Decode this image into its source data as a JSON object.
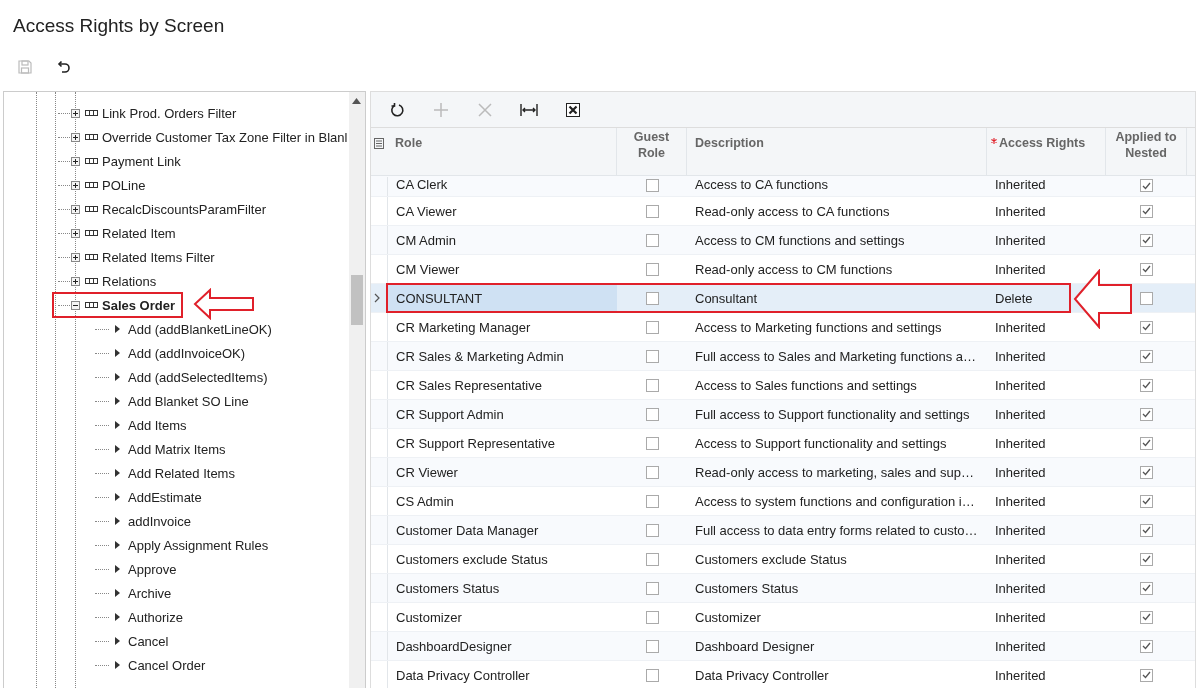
{
  "page": {
    "title": "Access Rights by Screen"
  },
  "toolbar": [
    {
      "kind": "save",
      "disabled": true
    },
    {
      "kind": "undo",
      "disabled": false
    }
  ],
  "tree": {
    "items": [
      {
        "label": "Link Prod. Orders Filter",
        "expanded": false,
        "highlighted": false
      },
      {
        "label": "Override Customer Tax Zone Filter in Blanl",
        "expanded": false,
        "highlighted": false
      },
      {
        "label": "Payment Link",
        "expanded": false,
        "highlighted": false
      },
      {
        "label": "POLine",
        "expanded": false,
        "highlighted": false
      },
      {
        "label": "RecalcDiscountsParamFilter",
        "expanded": false,
        "highlighted": false
      },
      {
        "label": "Related Item",
        "expanded": false,
        "highlighted": false
      },
      {
        "label": "Related Items Filter",
        "expanded": false,
        "highlighted": false
      },
      {
        "label": "Relations",
        "expanded": false,
        "highlighted": false
      },
      {
        "label": "Sales Order",
        "expanded": true,
        "highlighted": true,
        "children": [
          {
            "label": "Add (addBlanketLineOK)",
            "expanded": false
          },
          {
            "label": "Add (addInvoiceOK)",
            "expanded": false
          },
          {
            "label": "Add (addSelectedItems)",
            "expanded": false
          },
          {
            "label": "Add Blanket SO Line",
            "expanded": false
          },
          {
            "label": "Add Items",
            "expanded": false
          },
          {
            "label": "Add Matrix Items",
            "expanded": false
          },
          {
            "label": "Add Related Items",
            "expanded": false
          },
          {
            "label": "AddEstimate",
            "expanded": false
          },
          {
            "label": "addInvoice",
            "expanded": false
          },
          {
            "label": "Apply Assignment Rules",
            "expanded": false
          },
          {
            "label": "Approve",
            "expanded": false
          },
          {
            "label": "Archive",
            "expanded": false
          },
          {
            "label": "Authorize",
            "expanded": false
          },
          {
            "label": "Cancel",
            "expanded": false
          },
          {
            "label": "Cancel Order",
            "expanded": false
          }
        ]
      }
    ]
  },
  "grid": {
    "toolbar": [
      {
        "kind": "refresh",
        "disabled": false
      },
      {
        "kind": "add",
        "disabled": true
      },
      {
        "kind": "delete",
        "disabled": true
      },
      {
        "kind": "fit",
        "disabled": false
      },
      {
        "kind": "excel",
        "disabled": false
      }
    ],
    "columns": [
      {
        "label": "Role",
        "required": false
      },
      {
        "label": "Guest Role",
        "required": false
      },
      {
        "label": "Description",
        "required": false
      },
      {
        "label": "Access Rights",
        "required": true
      },
      {
        "label": "Applied to Nested",
        "required": false
      }
    ],
    "rows": [
      {
        "role": "CA Clerk",
        "guest_role": false,
        "description": "Access to CA functions",
        "access_rights": "Inherited",
        "applied_to_nested": true,
        "selected": false,
        "highlighted": false
      },
      {
        "role": "CA Viewer",
        "guest_role": false,
        "description": "Read-only access to CA functions",
        "access_rights": "Inherited",
        "applied_to_nested": true,
        "selected": false,
        "highlighted": false
      },
      {
        "role": "CM Admin",
        "guest_role": false,
        "description": "Access to CM functions and settings",
        "access_rights": "Inherited",
        "applied_to_nested": true,
        "selected": false,
        "highlighted": false
      },
      {
        "role": "CM Viewer",
        "guest_role": false,
        "description": "Read-only access to CM functions",
        "access_rights": "Inherited",
        "applied_to_nested": true,
        "selected": false,
        "highlighted": false
      },
      {
        "role": "CONSULTANT",
        "guest_role": false,
        "description": "Consultant",
        "access_rights": "Delete",
        "applied_to_nested": false,
        "selected": true,
        "highlighted": true
      },
      {
        "role": "CR Marketing Manager",
        "guest_role": false,
        "description": "Access to Marketing functions and settings",
        "access_rights": "Inherited",
        "applied_to_nested": true,
        "selected": false,
        "highlighted": false
      },
      {
        "role": "CR Sales & Marketing Admin",
        "guest_role": false,
        "description": "Full access to Sales and Marketing functions a…",
        "access_rights": "Inherited",
        "applied_to_nested": true,
        "selected": false,
        "highlighted": false
      },
      {
        "role": "CR Sales Representative",
        "guest_role": false,
        "description": "Access to Sales functions and settings",
        "access_rights": "Inherited",
        "applied_to_nested": true,
        "selected": false,
        "highlighted": false
      },
      {
        "role": "CR Support Admin",
        "guest_role": false,
        "description": "Full access to Support functionality and settings",
        "access_rights": "Inherited",
        "applied_to_nested": true,
        "selected": false,
        "highlighted": false
      },
      {
        "role": "CR Support Representative",
        "guest_role": false,
        "description": "Access to Support functionality and settings",
        "access_rights": "Inherited",
        "applied_to_nested": true,
        "selected": false,
        "highlighted": false
      },
      {
        "role": "CR Viewer",
        "guest_role": false,
        "description": "Read-only access to marketing, sales and sup…",
        "access_rights": "Inherited",
        "applied_to_nested": true,
        "selected": false,
        "highlighted": false
      },
      {
        "role": "CS Admin",
        "guest_role": false,
        "description": "Access to system functions and configuration i…",
        "access_rights": "Inherited",
        "applied_to_nested": true,
        "selected": false,
        "highlighted": false
      },
      {
        "role": "Customer Data Manager",
        "guest_role": false,
        "description": "Full access to data entry forms related to custo…",
        "access_rights": "Inherited",
        "applied_to_nested": true,
        "selected": false,
        "highlighted": false
      },
      {
        "role": "Customers exclude Status",
        "guest_role": false,
        "description": "Customers exclude Status",
        "access_rights": "Inherited",
        "applied_to_nested": true,
        "selected": false,
        "highlighted": false
      },
      {
        "role": "Customers Status",
        "guest_role": false,
        "description": "Customers Status",
        "access_rights": "Inherited",
        "applied_to_nested": true,
        "selected": false,
        "highlighted": false
      },
      {
        "role": "Customizer",
        "guest_role": false,
        "description": "Customizer",
        "access_rights": "Inherited",
        "applied_to_nested": true,
        "selected": false,
        "highlighted": false
      },
      {
        "role": "DashboardDesigner",
        "guest_role": false,
        "description": "Dashboard Designer",
        "access_rights": "Inherited",
        "applied_to_nested": true,
        "selected": false,
        "highlighted": false
      },
      {
        "role": "Data Privacy Controller",
        "guest_role": false,
        "description": "Data Privacy Controller",
        "access_rights": "Inherited",
        "applied_to_nested": true,
        "selected": false,
        "highlighted": false
      }
    ]
  }
}
